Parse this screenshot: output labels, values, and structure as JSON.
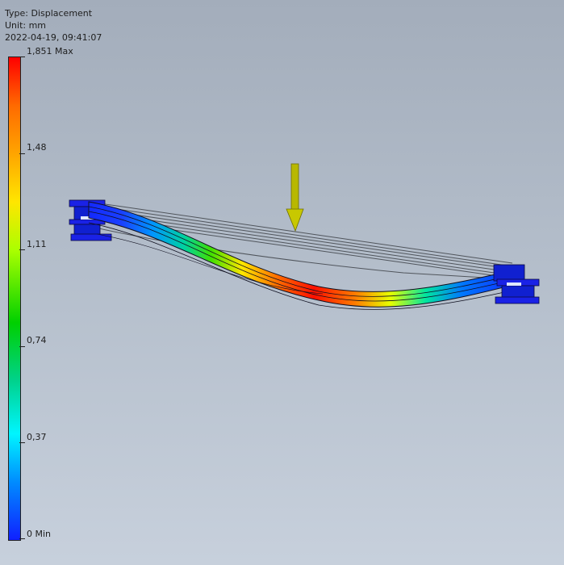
{
  "header": {
    "type_label": "Type: Displacement",
    "unit_label": "Unit: mm",
    "timestamp": "2022-04-19, 09:41:07"
  },
  "legend": {
    "max_label": "1,851 Max",
    "ticks": [
      "1,48",
      "1,11",
      "0,74",
      "0,37"
    ],
    "min_label": "0 Min"
  },
  "colors": {
    "scale_max": "#ff0000",
    "scale_mid": "#00d000",
    "scale_min": "#1020ff",
    "load_arrow": "#b8b800"
  },
  "icons": {
    "load": "load-arrow-icon"
  }
}
